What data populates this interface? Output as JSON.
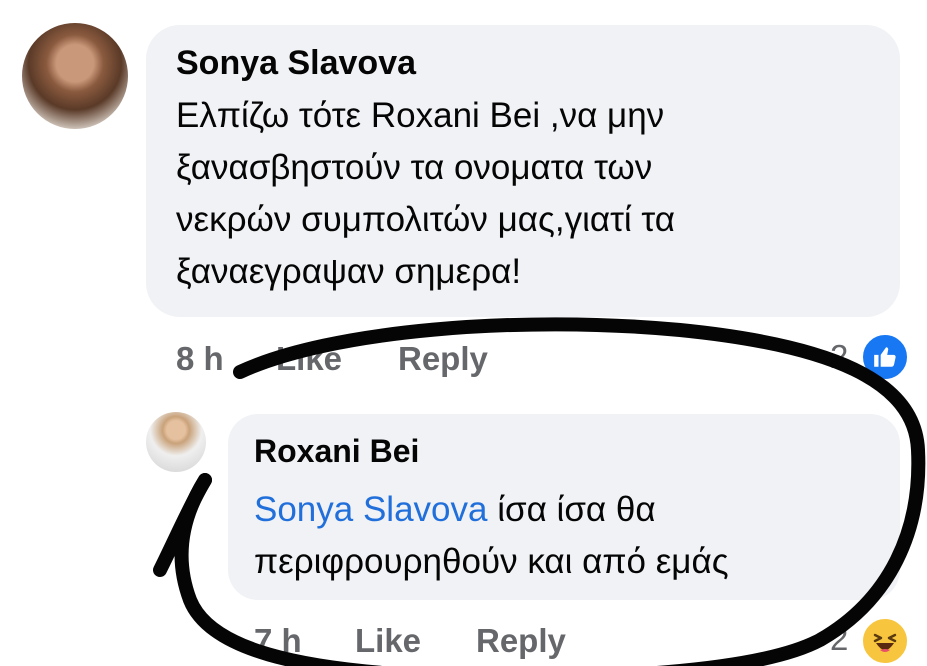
{
  "comment": {
    "author": "Sonya Slavova",
    "text": "Ελπίζω τότε Roxani Bei ,να μην\nξανασβηστούν τα ονοματα των\nνεκρών συμπολιτών μας,γιατί τα\nξαναεγραψαν σημερα!",
    "time": "8 h",
    "like_label": "Like",
    "reply_label": "Reply",
    "reaction_count": "2",
    "reaction_icon": "like-icon"
  },
  "reply": {
    "author": "Roxani Bei",
    "mention": "Sonya Slavova",
    "text_line1": " ίσα ίσα θα",
    "text_line2": "περιφρουρηθούν και από εμάς",
    "time": "7 h",
    "like_label": "Like",
    "reply_label": "Reply",
    "reaction_count": "2",
    "reaction_icon": "haha-icon"
  },
  "colors": {
    "bubble": "#f0f2f5",
    "mention": "#216fdb",
    "meta": "#65676b",
    "like_blue": "#1877f2",
    "haha_yellow": "#f7c53e",
    "annotation": "#050505"
  }
}
